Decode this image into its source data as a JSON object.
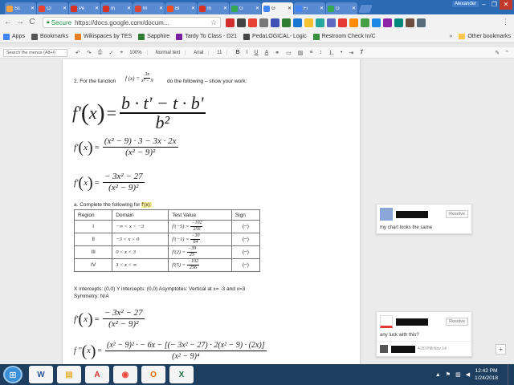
{
  "browser": {
    "tabs": [
      {
        "label": "Sc",
        "color": "#f4a340"
      },
      {
        "label": "Cl",
        "color": "#e94235"
      },
      {
        "label": "Pe",
        "color": "#d93025"
      },
      {
        "label": "In",
        "color": "#d93025"
      },
      {
        "label": "M",
        "color": "#db4437"
      },
      {
        "label": "Bl",
        "color": "#f25022"
      },
      {
        "label": "In",
        "color": "#d93025"
      },
      {
        "label": "G",
        "color": "#34a853"
      },
      {
        "label": "G",
        "color": "#4285f4",
        "active": true
      },
      {
        "label": "Fi",
        "color": "#4285f4"
      },
      {
        "label": "G",
        "color": "#34a853"
      }
    ],
    "user": "Alexander",
    "window_controls": {
      "minimize": "–",
      "maximize": "❐",
      "close": "✕"
    },
    "nav": {
      "back": "←",
      "forward": "→",
      "reload": "C"
    },
    "secure_label": "Secure",
    "url": "https://docs.google.com/docum...",
    "menu_icon": "⋮"
  },
  "bookmarks": {
    "items": [
      {
        "label": "Apps",
        "color": "#4285f4"
      },
      {
        "label": "Bookmarks",
        "color": "#555555"
      },
      {
        "label": "Wikispaces by TES",
        "color": "#e67e22"
      },
      {
        "label": "Sapphire",
        "color": "#2e7d32"
      },
      {
        "label": "Tardy To Class - D21",
        "color": "#7b1fa2"
      },
      {
        "label": "PedaLOGICAL- Logic",
        "color": "#444444"
      },
      {
        "label": "Restroom Check In/C",
        "color": "#388e3c"
      }
    ],
    "more": "»",
    "other": "Other bookmarks"
  },
  "docs_toolbar": {
    "search_placeholder": "Search the menus (Alt+/)",
    "zoom": "100%",
    "style": "Normal text",
    "font": "Arial",
    "size": "11",
    "bold": "B",
    "italic": "I",
    "underline": "U",
    "text_color": "A"
  },
  "document": {
    "problem_intro": "2. For the function",
    "given_function": {
      "lhs": "f (x) =",
      "num": "3x",
      "den": "x² − 9"
    },
    "problem_outro": "do the following – show your work:",
    "quotient_rule": {
      "lhs": "f'",
      "arg": "x",
      "num": "b · t' − t · b'",
      "den": "b²"
    },
    "step1": {
      "lhs": "f'",
      "arg": "x",
      "num": "(x² − 9) · 3 − 3x · 2x",
      "den": "(x² − 9)²"
    },
    "step2": {
      "lhs": "f'",
      "arg": "x",
      "num": "− 3x² − 27",
      "den": "(x² − 9)²"
    },
    "table_intro": "a. Complete the following for",
    "table_target": "f'(x):",
    "table": {
      "headers": [
        "Region",
        "Domain",
        "Test Value",
        "Sign"
      ],
      "rows": [
        {
          "region": "I",
          "domain": "−∞ < x < −3",
          "test_lhs": "f'(−5) =",
          "test_num": "−102",
          "test_den": "256",
          "sign": "(−)"
        },
        {
          "region": "II",
          "domain": "−3 < x < 0",
          "test_lhs": "f'(−1) =",
          "test_num": "−30",
          "test_den": "64",
          "sign": "(−)"
        },
        {
          "region": "III",
          "domain": "0 < x < 3",
          "test_lhs": "f'(2) =",
          "test_num": "−39",
          "test_den": "25",
          "sign": "(−)"
        },
        {
          "region": "IV",
          "domain": "3 < x < ∞",
          "test_lhs": "f'(5) =",
          "test_num": "−102",
          "test_den": "256",
          "sign": "(−)"
        }
      ]
    },
    "intercepts_line": "X intercepts:  (0,0)        Y intercepts:  (0,0)        Asymptotes: Vertical at x= -3 and x=3",
    "symmetry_line": "Symmetry: N/A",
    "step3": {
      "lhs": "f'",
      "arg": "x",
      "num": "− 3x² − 27",
      "den": "(x² − 9)²"
    },
    "second_derivative": {
      "lhs": "f ''",
      "arg": "x",
      "num": "(x² − 9)² · − 6x − [(− 3x² − 27) · 2(x² − 9) · (2x)]",
      "den": "(x² − 9)⁴"
    }
  },
  "comments": [
    {
      "resolve_label": "Resolve",
      "body": "my chart looks the same"
    },
    {
      "resolve_label": "Resolve",
      "body": "any luck with this?",
      "reply_time": "4:20 PM Nov 14"
    }
  ],
  "add_comment_icon": "+",
  "taskbar": {
    "apps": [
      {
        "label": "W",
        "color": "#2b579a"
      },
      {
        "label": "▤",
        "color": "#e8b339"
      },
      {
        "label": "A",
        "color": "#d32f2f"
      },
      {
        "label": "◉",
        "color": "#e94235"
      },
      {
        "label": "O",
        "color": "#e06c00"
      },
      {
        "label": "X",
        "color": "#1d6f42"
      }
    ],
    "time": "12:42 PM",
    "date": "1/24/2018"
  }
}
